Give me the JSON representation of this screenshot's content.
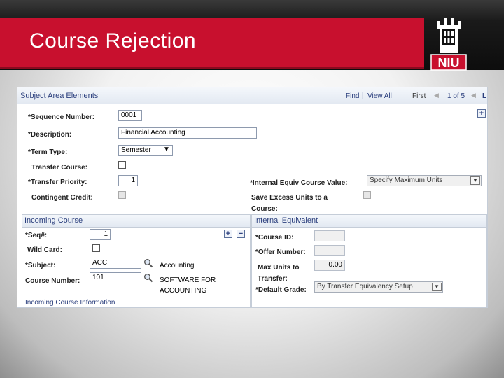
{
  "slide": {
    "title": "Course Rejection",
    "logo_text": "NIU"
  },
  "panel": {
    "title": "Subject Area Elements",
    "find": "Find",
    "sep": "|",
    "view_all": "View All",
    "first": "First",
    "paging": "1 of 5",
    "last": "L",
    "fields": {
      "sequence_label": "*Sequence Number:",
      "sequence_value": "0001",
      "description_label": "*Description:",
      "description_value": "Financial Accounting",
      "term_type_label": "*Term Type:",
      "term_type_value": "Semester",
      "transfer_course_label": "Transfer Course:",
      "transfer_priority_label": "*Transfer Priority:",
      "transfer_priority_value": "1",
      "contingent_credit_label": "Contingent Credit:",
      "equiv_value_label": "*Internal Equiv Course Value:",
      "equiv_value_value": "Specify Maximum Units",
      "save_excess_label_1": "Save Excess Units to a",
      "save_excess_label_2": "Course:"
    },
    "incoming": {
      "title": "Incoming Course",
      "seq_label": "*Seq#:",
      "seq_value": "1",
      "wildcard_label": "Wild Card:",
      "subject_label": "*Subject:",
      "subject_value": "ACC",
      "subject_desc": "Accounting",
      "course_number_label": "Course Number:",
      "course_number_value": "101",
      "course_desc_1": "SOFTWARE FOR",
      "course_desc_2": "ACCOUNTING",
      "info_link": "Incoming Course Information"
    },
    "internal": {
      "title": "Internal Equivalent",
      "course_id_label": "*Course ID:",
      "offer_number_label": "*Offer Number:",
      "max_units_label_1": "Max Units to",
      "max_units_label_2": "Transfer:",
      "max_units_value": "0.00",
      "default_grade_label": "*Default Grade:",
      "default_grade_value": "By Transfer Equivalency Setup"
    },
    "icons": {
      "add": "+",
      "remove": "−",
      "prev": "◀",
      "dropdown": "▼"
    }
  },
  "colors": {
    "brand_red": "#c8102e",
    "link_blue": "#2b3f7d"
  }
}
